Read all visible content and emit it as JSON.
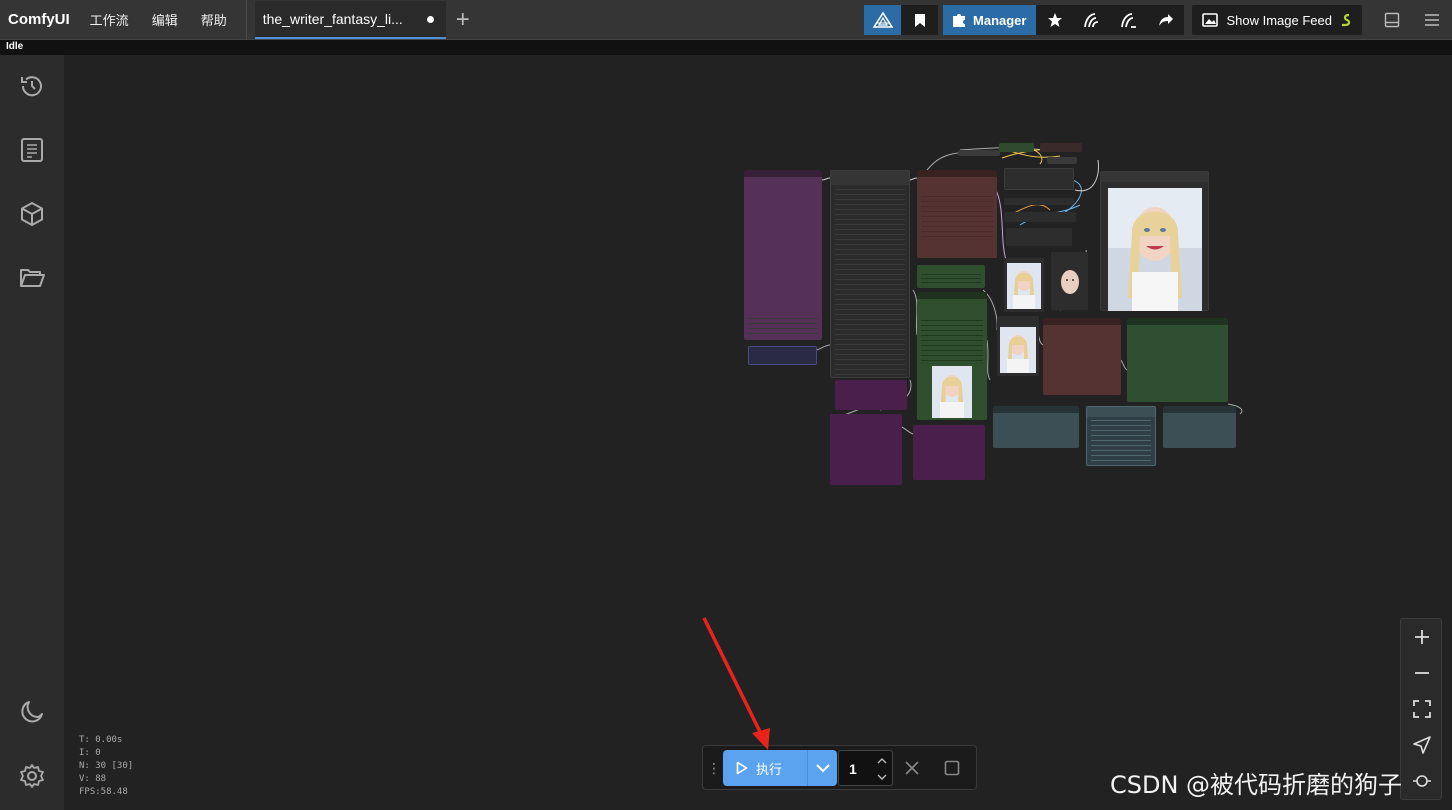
{
  "app": {
    "brand": "ComfyUI"
  },
  "menu": [
    "工作流",
    "编辑",
    "帮助"
  ],
  "tab": {
    "title": "the_writer_fantasy_li..."
  },
  "toolbar": {
    "manager_label": "Manager",
    "image_feed_label": "Show Image Feed"
  },
  "status": "Idle",
  "stats": [
    "T: 0.00s",
    "I: 0",
    "N: 30 [30]",
    "V: 88",
    "FPS:58.48"
  ],
  "execute": {
    "run_label": "执行",
    "batch_count": "1"
  },
  "watermark": "CSDN @被代码折磨的狗子",
  "colors": {
    "accent": "#5ca3ef",
    "manager_blue": "#2b6ca6",
    "annotation_arrow": "#e8231b"
  },
  "icons": {
    "sidebar": [
      "history-icon",
      "book-icon",
      "cube-icon",
      "folder-open-icon",
      "moon-icon",
      "settings-icon"
    ],
    "zoom": [
      "zoom-in-icon",
      "zoom-out-icon",
      "fit-view-icon",
      "locate-icon",
      "link-visibility-icon"
    ]
  }
}
